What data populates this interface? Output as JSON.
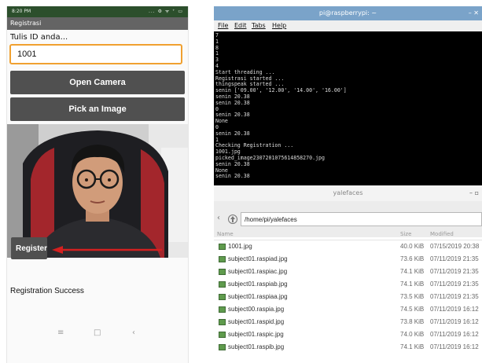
{
  "phone": {
    "status_time": "8:20 PM",
    "status_icons": "... ⚙ ᯤ ⁺ ▭",
    "app_title": "Registrasi",
    "prompt": "Tulis ID anda...",
    "id_value": "1001",
    "open_camera_label": "Open Camera",
    "pick_image_label": "Pick an Image",
    "register_label": "Register",
    "status_text": "Registration Success",
    "nav": {
      "menu": "≡",
      "home": "□",
      "back": "‹"
    }
  },
  "terminal": {
    "title": "pi@raspberrypi: ~",
    "window_controls": "–  ✕",
    "menu": {
      "file": "File",
      "edit": "Edit",
      "tabs": "Tabs",
      "help": "Help"
    },
    "lines": [
      "7",
      "1",
      "8",
      "1",
      "3",
      "4",
      "Start threading ...",
      "Registrasi started ...",
      "thingspeak started ...",
      "senin ['09.00', '12.00', '14.00', '16.00']",
      "senin 20.38",
      "senin 20.38",
      "0",
      "senin 20.38",
      "None",
      "0",
      "senin 20.38",
      "1",
      "Checking Registration ...",
      "1001.jpg",
      "picked_image2307201075614858270.jpg",
      "senin 20.38",
      "None",
      "senin 20.38"
    ]
  },
  "file_manager": {
    "title": "yalefaces",
    "window_controls": "–  ▫",
    "path": "/home/pi/yalefaces",
    "columns": {
      "name": "Name",
      "size": "Size",
      "modified": "Modified"
    },
    "files": [
      {
        "name": "1001.jpg",
        "size": "40.0 KiB",
        "modified": "07/15/2019 20:38"
      },
      {
        "name": "subject01.raspiad.jpg",
        "size": "73.6 KiB",
        "modified": "07/11/2019 21:35"
      },
      {
        "name": "subject01.raspiac.jpg",
        "size": "74.1 KiB",
        "modified": "07/11/2019 21:35"
      },
      {
        "name": "subject01.raspiab.jpg",
        "size": "74.1 KiB",
        "modified": "07/11/2019 21:35"
      },
      {
        "name": "subject01.raspiaa.jpg",
        "size": "73.5 KiB",
        "modified": "07/11/2019 21:35"
      },
      {
        "name": "subject00.raspia.jpg",
        "size": "74.5 KiB",
        "modified": "07/11/2019 16:12"
      },
      {
        "name": "subject01.raspid.jpg",
        "size": "73.8 KiB",
        "modified": "07/11/2019 16:12"
      },
      {
        "name": "subject01.raspic.jpg",
        "size": "74.0 KiB",
        "modified": "07/11/2019 16:12"
      },
      {
        "name": "subject01.raspib.jpg",
        "size": "74.1 KiB",
        "modified": "07/11/2019 16:12"
      }
    ]
  },
  "colors": {
    "statusbar": "#2c4f2c",
    "appbar": "#646464",
    "input_focus": "#f0a030",
    "button": "#505050",
    "terminal_title": "#7aa3c9",
    "annotation_arrow": "#d42020"
  }
}
